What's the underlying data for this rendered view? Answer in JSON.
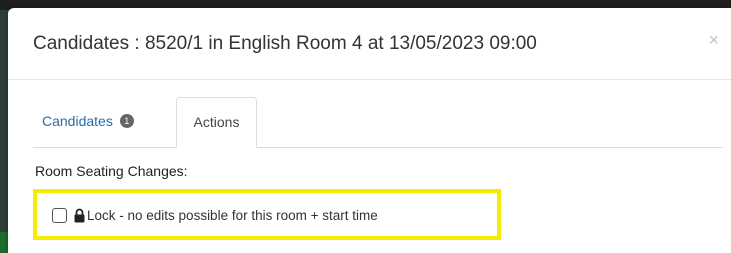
{
  "modal": {
    "title": "Candidates : 8520/1 in English Room 4 at 13/05/2023 09:00",
    "close_label": "×"
  },
  "tabs": [
    {
      "label": "Candidates",
      "badge": "1",
      "active": false
    },
    {
      "label": "Actions",
      "active": true
    }
  ],
  "actions": {
    "section_label": "Room Seating Changes:",
    "lock_option": {
      "label": "Lock - no edits possible for this room + start time",
      "checked": false,
      "icon": "lock-icon"
    }
  },
  "colors": {
    "link": "#2a6ca8",
    "highlight": "#f5ec00"
  }
}
